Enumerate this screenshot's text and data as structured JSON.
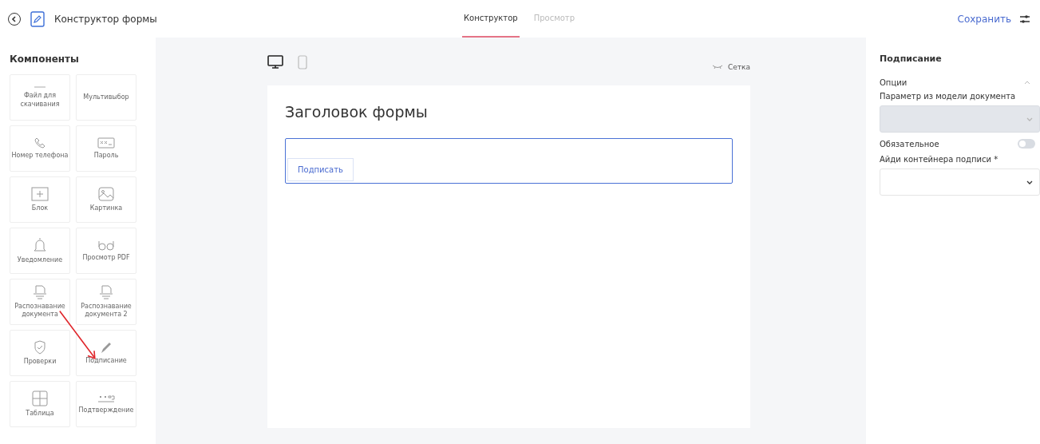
{
  "header": {
    "title": "Конструктор формы",
    "tabs": [
      {
        "label": "Конструктор",
        "selected": true
      },
      {
        "label": "Просмотр",
        "selected": false
      }
    ],
    "save": "Сохранить"
  },
  "components": {
    "title": "Компоненты",
    "items": [
      {
        "label": "Файл для скачивания"
      },
      {
        "label": "Мультивыбор"
      },
      {
        "label": "Номер телефона"
      },
      {
        "label": "Пароль"
      },
      {
        "label": "Блок"
      },
      {
        "label": "Картинка"
      },
      {
        "label": "Уведомление"
      },
      {
        "label": "Просмотр PDF"
      },
      {
        "label": "Распознавание документа"
      },
      {
        "label": "Распознавание документа 2"
      },
      {
        "label": "Проверки"
      },
      {
        "label": "Подписание"
      },
      {
        "label": "Таблица"
      },
      {
        "label": "Подтверждение"
      }
    ]
  },
  "canvas": {
    "devices": [
      {
        "kind": "desktop",
        "selected": true
      },
      {
        "kind": "mobile",
        "selected": false
      }
    ],
    "grid": {
      "label": "Сетка",
      "on": false
    },
    "form_title": "Заголовок формы",
    "sign_button": "Подписать"
  },
  "properties": {
    "title": "Подписание",
    "section": {
      "label": "Опции",
      "expanded": true
    },
    "fields": [
      {
        "kind": "select",
        "label": "Параметр из модели документа",
        "disabled": true
      },
      {
        "kind": "toggle",
        "label": "Обязательное",
        "on": false
      },
      {
        "kind": "select",
        "label": "Айди контейнера подписи *",
        "disabled": false
      }
    ]
  }
}
